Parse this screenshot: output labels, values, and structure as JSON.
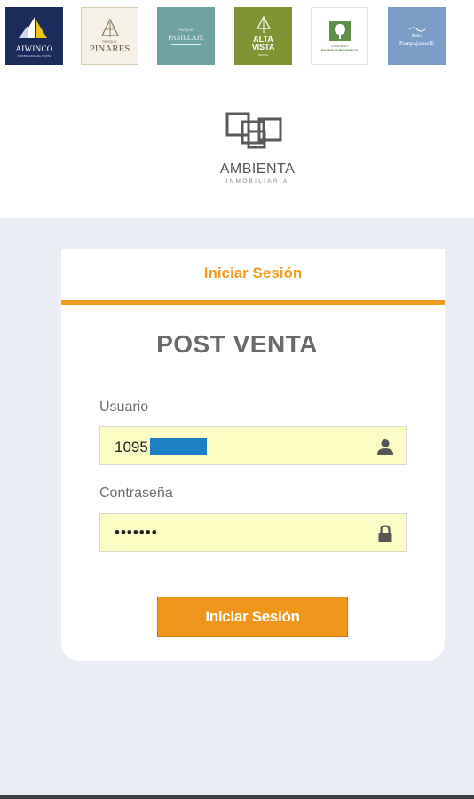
{
  "partner_logos": [
    {
      "name": "AIWINCO",
      "sub": "INMOBILIARIA DEL NORTE",
      "bg": "#1b2c5c",
      "fg": "#ffffff"
    },
    {
      "name": "PINARES",
      "top": "PARQUE",
      "bg": "#f6f1e6",
      "fg": "#6e5f46"
    },
    {
      "name": "PASILLAJE",
      "top": "PARQUE",
      "bg": "#6fa2a3",
      "fg": "#e8f1f1"
    },
    {
      "name": "ALTA VISTA",
      "sub": "RESIDE",
      "bg": "#7f9435",
      "fg": "#ffffff"
    },
    {
      "name": "MAGNOLIA RESIDENCIA",
      "top": "CONDOMINIO",
      "bg": "#ffffff",
      "fg": "#4a7a3a"
    },
    {
      "name": "Pampajasuelli",
      "top": "Bello",
      "bg": "#7b9ec9",
      "fg": "#ffffff"
    }
  ],
  "brand": {
    "name": "AMBIENTA",
    "subtitle": "INMOBILIARIA"
  },
  "login": {
    "tab_label": "Iniciar Sesión",
    "title": "POST VENTA",
    "username_label": "Usuario",
    "username_value": "1095",
    "password_label": "Contraseña",
    "password_value": "•••••••",
    "submit_label": "Iniciar Sesión"
  },
  "colors": {
    "accent": "#f29c22",
    "field_bg": "#fbfdc4",
    "page_bg": "#eaedf4",
    "redaction": "#1f7fc4"
  }
}
